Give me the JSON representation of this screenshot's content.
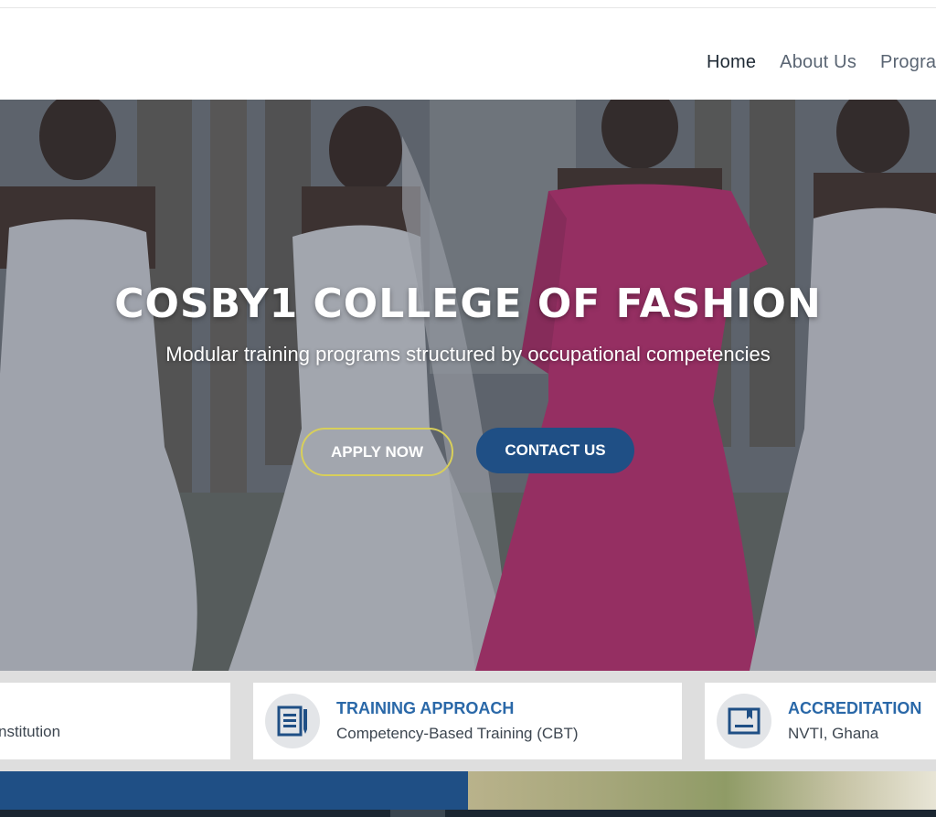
{
  "nav": {
    "items": [
      {
        "label": "Home",
        "active": true
      },
      {
        "label": "About Us",
        "active": false
      },
      {
        "label": "Progra",
        "active": false
      }
    ]
  },
  "hero": {
    "title": "COSBY1 COLLEGE OF FASHION",
    "subtitle": "Modular training programs structured by occupational competencies",
    "apply_label": "APPLY NOW",
    "contact_label": "CONTACT US"
  },
  "info_cards": [
    {
      "title": "",
      "desc": "nstitution",
      "icon": "institution-icon"
    },
    {
      "title": "TRAINING APPROACH",
      "desc": "Competency-Based Training (CBT)",
      "icon": "document-icon"
    },
    {
      "title": "ACCREDITATION",
      "desc": "NVTI, Ghana",
      "icon": "certificate-icon"
    }
  ],
  "colors": {
    "primary": "#1f4f85",
    "accent_title": "#2a68a8",
    "apply_border": "#d8cf5a",
    "band": "#dedede"
  }
}
